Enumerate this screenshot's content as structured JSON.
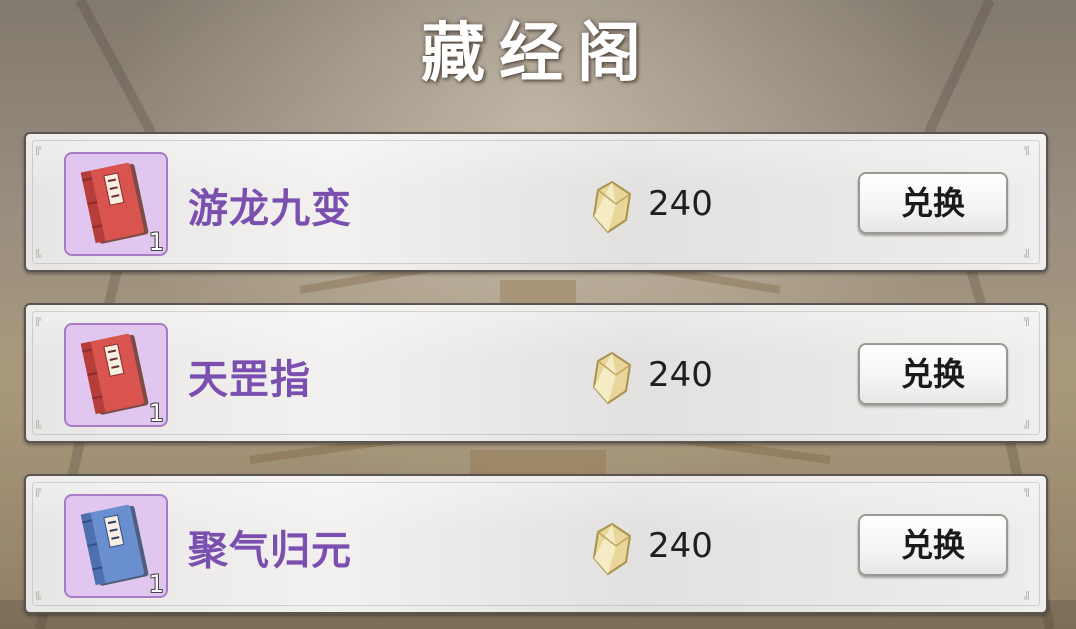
{
  "title": "藏经阁",
  "currency_icon": "crystal-icon",
  "items": [
    {
      "name": "游龙九变",
      "quantity": "1",
      "cost": "240",
      "button": "兑换",
      "book_color": "red",
      "book_icon": "book-icon"
    },
    {
      "name": "天罡指",
      "quantity": "1",
      "cost": "240",
      "button": "兑换",
      "book_color": "red",
      "book_icon": "book-icon"
    },
    {
      "name": "聚气归元",
      "quantity": "1",
      "cost": "240",
      "button": "兑换",
      "book_color": "blue",
      "book_icon": "book-icon"
    }
  ],
  "colors": {
    "name_purple": "#7b4fb0",
    "icon_bg": "#e1c6ef",
    "red_book": "#d9534f",
    "blue_book": "#6a8fd1"
  }
}
